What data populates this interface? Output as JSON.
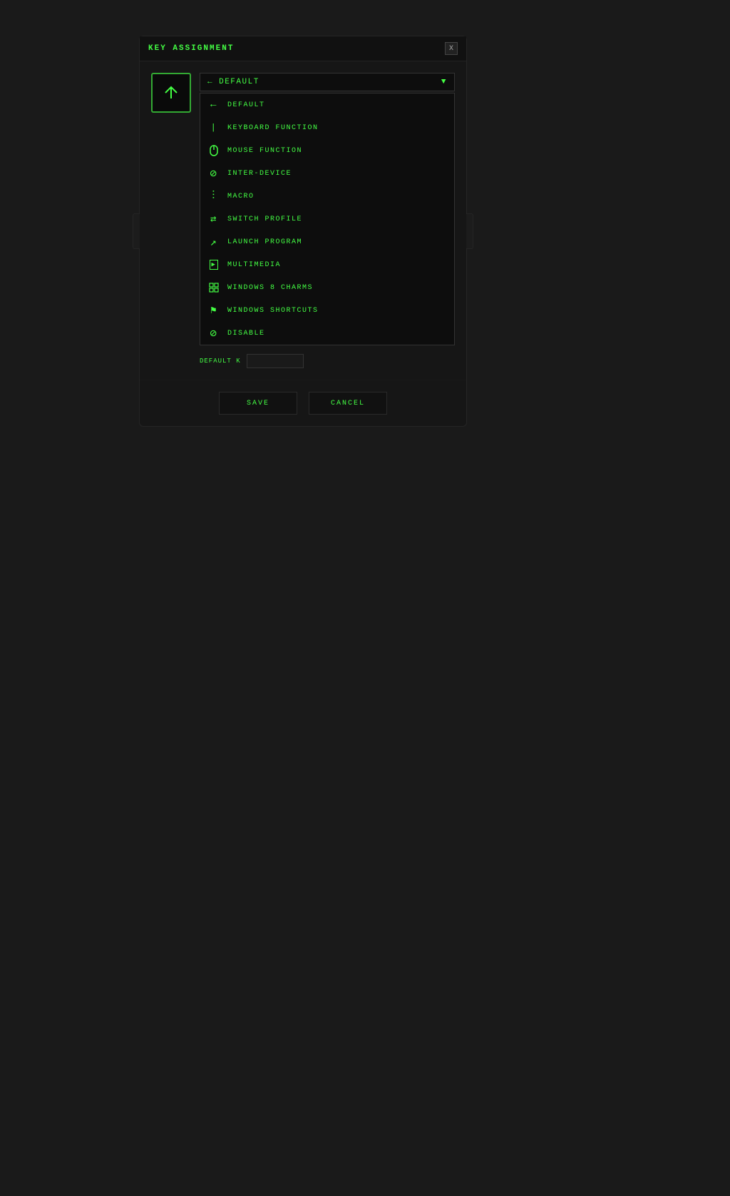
{
  "dialog": {
    "title": "KEY ASSIGNMENT",
    "close_label": "X",
    "dropdown": {
      "selected_label": "DEFAULT",
      "items": [
        {
          "id": "default",
          "icon": "arrow-left-icon",
          "label": "DEFAULT"
        },
        {
          "id": "keyboard",
          "icon": "keyboard-icon",
          "label": "KEYBOARD FUNCTION"
        },
        {
          "id": "mouse",
          "icon": "mouse-icon",
          "label": "MOUSE FUNCTION"
        },
        {
          "id": "inter-device",
          "icon": "inter-device-icon",
          "label": "INTER-DEVICE"
        },
        {
          "id": "macro",
          "icon": "macro-icon",
          "label": "MACRO"
        },
        {
          "id": "switch-profile",
          "icon": "switch-profile-icon",
          "label": "SWITCH PROFILE"
        },
        {
          "id": "launch-program",
          "icon": "launch-program-icon",
          "label": "LAUNCH PROGRAM"
        },
        {
          "id": "multimedia",
          "icon": "multimedia-icon",
          "label": "MULTIMEDIA"
        },
        {
          "id": "windows8",
          "icon": "windows8-icon",
          "label": "WINDOWS 8 CHARMS"
        },
        {
          "id": "windows-shortcuts",
          "icon": "windows-shortcuts-icon",
          "label": "WINDOWS SHORTCUTS"
        },
        {
          "id": "disable",
          "icon": "disable-icon",
          "label": "DISABLE"
        }
      ]
    },
    "default_key_label": "DEFAULT K",
    "save_label": "SAVE",
    "cancel_label": "CANCEL"
  }
}
